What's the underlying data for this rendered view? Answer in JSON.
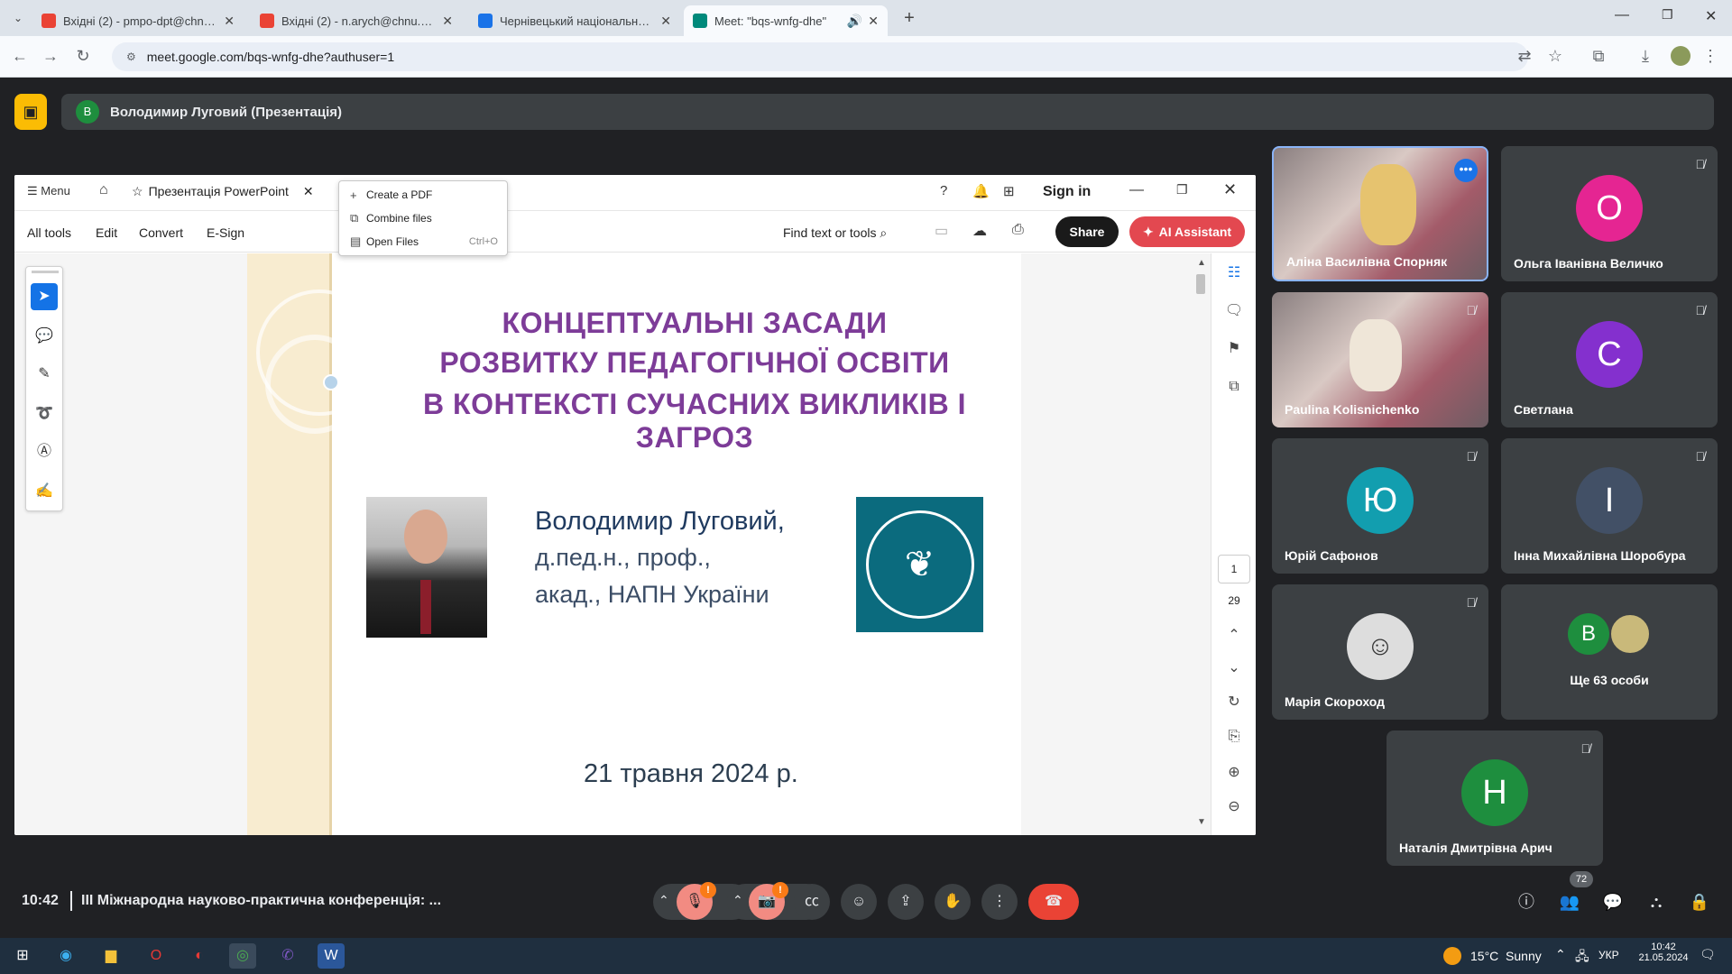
{
  "browser": {
    "tabs": [
      {
        "title": "Вхідні (2) - pmpo-dpt@chnu.edu.ua"
      },
      {
        "title": "Вхідні (2) - n.arych@chnu.edu.ua"
      },
      {
        "title": "Чернівецький національний університет"
      },
      {
        "title": "Meet: \"bqs-wnfg-dhe\""
      }
    ],
    "url": "meet.google.com/bqs-wnfg-dhe?authuser=1"
  },
  "meet": {
    "presenter_initial": "В",
    "presenter_label": "Володимир Луговий (Презентація)",
    "meeting_time": "10:42",
    "meeting_title": "III Міжнародна науково-практична конференція: ...",
    "participants_count": "72",
    "participants": [
      {
        "name": "Аліна Василівна Спорняк",
        "initial": "",
        "color": "#a35b69"
      },
      {
        "name": "Ольга Іванівна Величко",
        "initial": "О",
        "color": "#e52592"
      },
      {
        "name": "Paulina Kolisnichenko",
        "initial": "",
        "color": "#a35b69"
      },
      {
        "name": "Светлана",
        "initial": "С",
        "color": "#8430ce"
      },
      {
        "name": "Юрій Сафонов",
        "initial": "Ю",
        "color": "#129eaf"
      },
      {
        "name": "Інна Михайлівна Шоробура",
        "initial": "І",
        "color": "#425066"
      },
      {
        "name": "Марія Скороход",
        "initial": "",
        "color": "#555"
      },
      {
        "name": "Ще 63 особи",
        "initial": "В",
        "color": "#1e8e3e"
      },
      {
        "name": "Наталія Дмитрівна Арич",
        "initial": "Н",
        "color": "#1e8e3e"
      }
    ]
  },
  "acrobat": {
    "menu_label": "Menu",
    "tab_title": "Презентація PowerPoint",
    "sign_in": "Sign in",
    "toolbar": {
      "all_tools": "All tools",
      "edit": "Edit",
      "convert": "Convert",
      "esign": "E-Sign",
      "find": "Find text or tools",
      "share": "Share",
      "ai_assistant": "AI Assistant"
    },
    "dropdown": [
      {
        "label": "Create a PDF",
        "shortcut": ""
      },
      {
        "label": "Combine files",
        "shortcut": ""
      },
      {
        "label": "Open Files",
        "shortcut": "Ctrl+O"
      }
    ],
    "page_current": "1",
    "page_total": "29"
  },
  "slide": {
    "title_line1": "КОНЦЕПТУАЛЬНІ ЗАСАДИ",
    "title_line2": "РОЗВИТКУ ПЕДАГОГІЧНОЇ ОСВІТИ",
    "title_line3": "В КОНТЕКСТІ СУЧАСНИХ ВИКЛИКІВ І ЗАГРОЗ",
    "author_name": "Володимир Луговий,",
    "author_degree": "д.пед.н., проф.,",
    "author_title": "акад., НАПН України",
    "date": "21 травня 2024 р."
  },
  "taskbar": {
    "weather": "15°C  Sunny",
    "lang": "УКР",
    "clock_time": "10:42",
    "clock_date": "21.05.2024"
  }
}
